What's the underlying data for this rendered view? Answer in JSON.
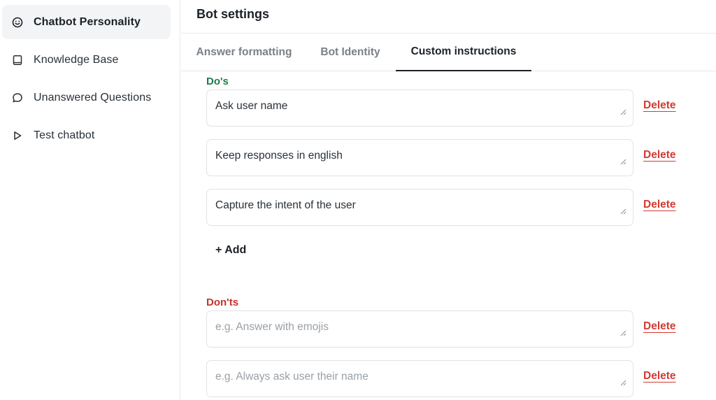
{
  "sidebar": {
    "items": [
      {
        "label": "Chatbot Personality",
        "icon": "smile-icon",
        "active": true
      },
      {
        "label": "Knowledge Base",
        "icon": "book-icon",
        "active": false
      },
      {
        "label": "Unanswered Questions",
        "icon": "chat-bubble-icon",
        "active": false
      },
      {
        "label": "Test chatbot",
        "icon": "play-icon",
        "active": false
      }
    ]
  },
  "header": {
    "title": "Bot settings"
  },
  "tabs": [
    {
      "label": "Answer formatting",
      "active": false
    },
    {
      "label": "Bot Identity",
      "active": false
    },
    {
      "label": "Custom instructions",
      "active": true
    }
  ],
  "dos": {
    "label": "Do's",
    "items": [
      {
        "value": "Ask user name"
      },
      {
        "value": "Keep responses in english"
      },
      {
        "value": "Capture the intent of the user"
      }
    ],
    "add_label": "+ Add"
  },
  "donts": {
    "label": "Don'ts",
    "items": [
      {
        "value": "",
        "placeholder": "e.g. Answer with emojis"
      },
      {
        "value": "",
        "placeholder": "e.g. Always ask user their name"
      }
    ]
  },
  "actions": {
    "delete_label": "Delete"
  },
  "colors": {
    "dos": "#1f7a4a",
    "donts": "#c7322c",
    "delete": "#d23b33"
  }
}
